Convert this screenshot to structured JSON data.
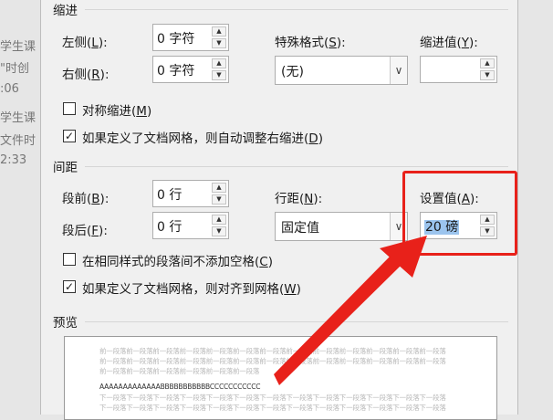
{
  "background": {
    "lines": [
      "学生课",
      "\"时创",
      ":06",
      "学生课",
      "文件时",
      "2:33"
    ]
  },
  "indent": {
    "section_title": "缩进",
    "left_label": "左侧(",
    "left_key": "L",
    "left_suffix": "):",
    "left_value": "0 字符",
    "right_label": "右侧(",
    "right_key": "R",
    "right_suffix": "):",
    "right_value": "0 字符",
    "special_label": "特殊格式(",
    "special_key": "S",
    "special_suffix": "):",
    "special_value": "(无)",
    "indent_value_label": "缩进值(",
    "indent_value_key": "Y",
    "indent_value_suffix": "):",
    "indent_value": "",
    "mirror_label": "对称缩进(",
    "mirror_key": "M",
    "mirror_suffix": ")",
    "mirror_checked": false,
    "auto_adjust_label": "如果定义了文档网格，则自动调整右缩进(",
    "auto_adjust_key": "D",
    "auto_adjust_suffix": ")",
    "auto_adjust_checked": true
  },
  "spacing": {
    "section_title": "间距",
    "before_label": "段前(",
    "before_key": "B",
    "before_suffix": "):",
    "before_value": "0 行",
    "after_label": "段后(",
    "after_key": "F",
    "after_suffix": "):",
    "after_value": "0 行",
    "line_spacing_label": "行距(",
    "line_spacing_key": "N",
    "line_spacing_suffix": "):",
    "line_spacing_value": "固定值",
    "set_value_label": "设置值(",
    "set_value_key": "A",
    "set_value_suffix": "):",
    "set_value_number": "20",
    "set_value_unit": "磅",
    "no_space_same_style_label": "在相同样式的段落间不添加空格(",
    "no_space_same_style_key": "C",
    "no_space_same_style_suffix": ")",
    "no_space_same_style_checked": false,
    "snap_grid_label": "如果定义了文档网格，则对齐到网格(",
    "snap_grid_key": "W",
    "snap_grid_suffix": ")",
    "snap_grid_checked": true
  },
  "preview": {
    "section_title": "预览",
    "prev_lines": [
      "前一段落前一段落前一段落前一段落前一段落前一段落前一段落前一段落前一段落前一段落前一段落前一段落前一段落",
      "前一段落前一段落前一段落前一段落前一段落前一段落前一段落前一段落前一段落前一段落前一段落前一段落前一段落",
      "前一段落前一段落前一段落前一段落前一段落前一段落"
    ],
    "sample_line": "AAAAAAAAAAAAABBBBBBBBBBBCCCCCCCCCCC",
    "next_lines": [
      "下一段落下一段落下一段落下一段落下一段落下一段落下一段落下一段落下一段落下一段落下一段落下一段落下一段落",
      "下一段落下一段落下一段落下一段落下一段落下一段落下一段落下一段落下一段落下一段落下一段落下一段落下一段落"
    ]
  },
  "annotation": {
    "color": "#e8211a"
  }
}
